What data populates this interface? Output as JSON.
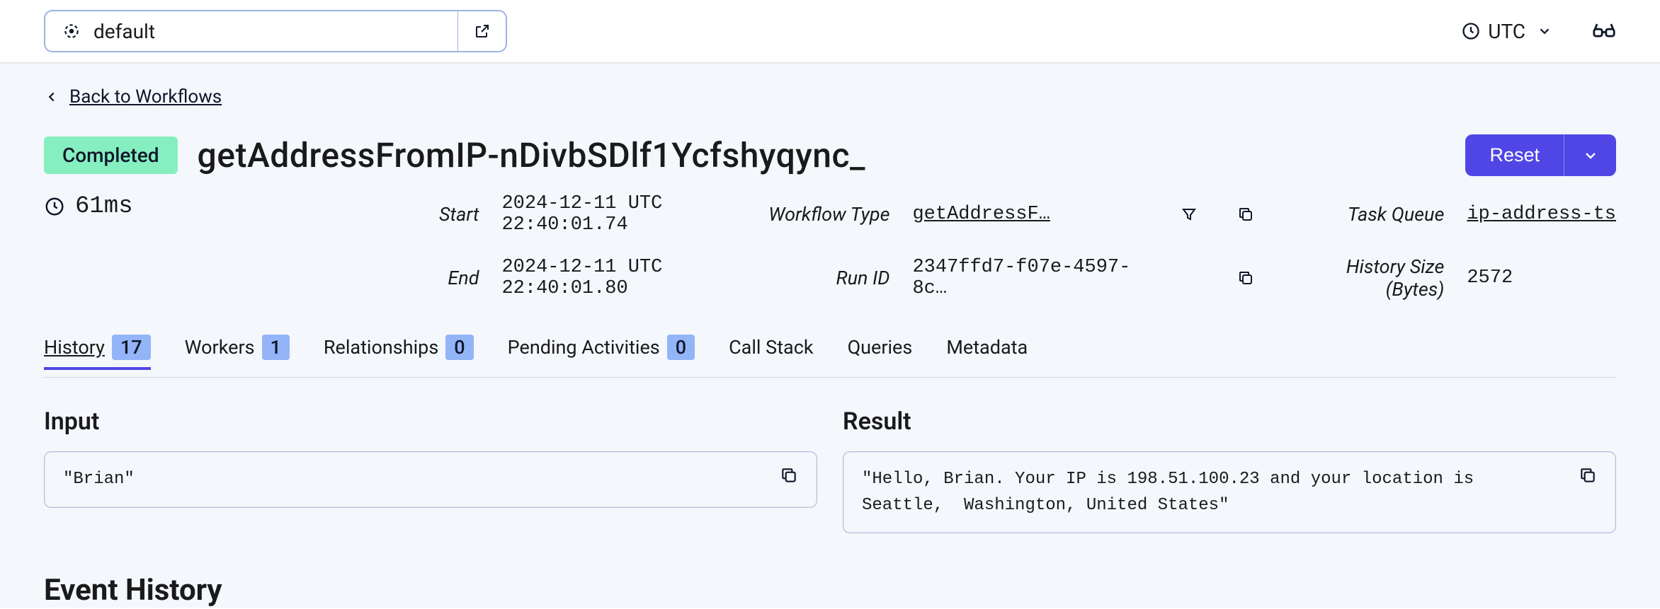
{
  "topbar": {
    "namespace": "default",
    "timezone": "UTC"
  },
  "back_link": "Back to Workflows",
  "status": "Completed",
  "workflow_id": "getAddressFromIP-nDivbSDlf1Ycfshyqync_",
  "reset_label": "Reset",
  "duration": "61ms",
  "meta": {
    "start_label": "Start",
    "start_value": "2024-12-11 UTC 22:40:01.74",
    "end_label": "End",
    "end_value": "2024-12-11 UTC 22:40:01.80",
    "wft_label": "Workflow Type",
    "wft_value": "getAddressF…",
    "runid_label": "Run ID",
    "runid_value": "2347ffd7-f07e-4597-8c…",
    "tq_label": "Task Queue",
    "tq_value": "ip-address-ts",
    "hsz_label": "History Size (Bytes)",
    "hsz_value": "2572"
  },
  "tabs": [
    {
      "label": "History",
      "count": "17",
      "active": true
    },
    {
      "label": "Workers",
      "count": "1"
    },
    {
      "label": "Relationships",
      "count": "0"
    },
    {
      "label": "Pending Activities",
      "count": "0"
    },
    {
      "label": "Call Stack"
    },
    {
      "label": "Queries"
    },
    {
      "label": "Metadata"
    }
  ],
  "io": {
    "input_title": "Input",
    "input_value": "\"Brian\"",
    "result_title": "Result",
    "result_value": "\"Hello, Brian. Your IP is 198.51.100.23 and your location is Seattle,  Washington, United States\""
  },
  "event_history_heading": "Event History"
}
